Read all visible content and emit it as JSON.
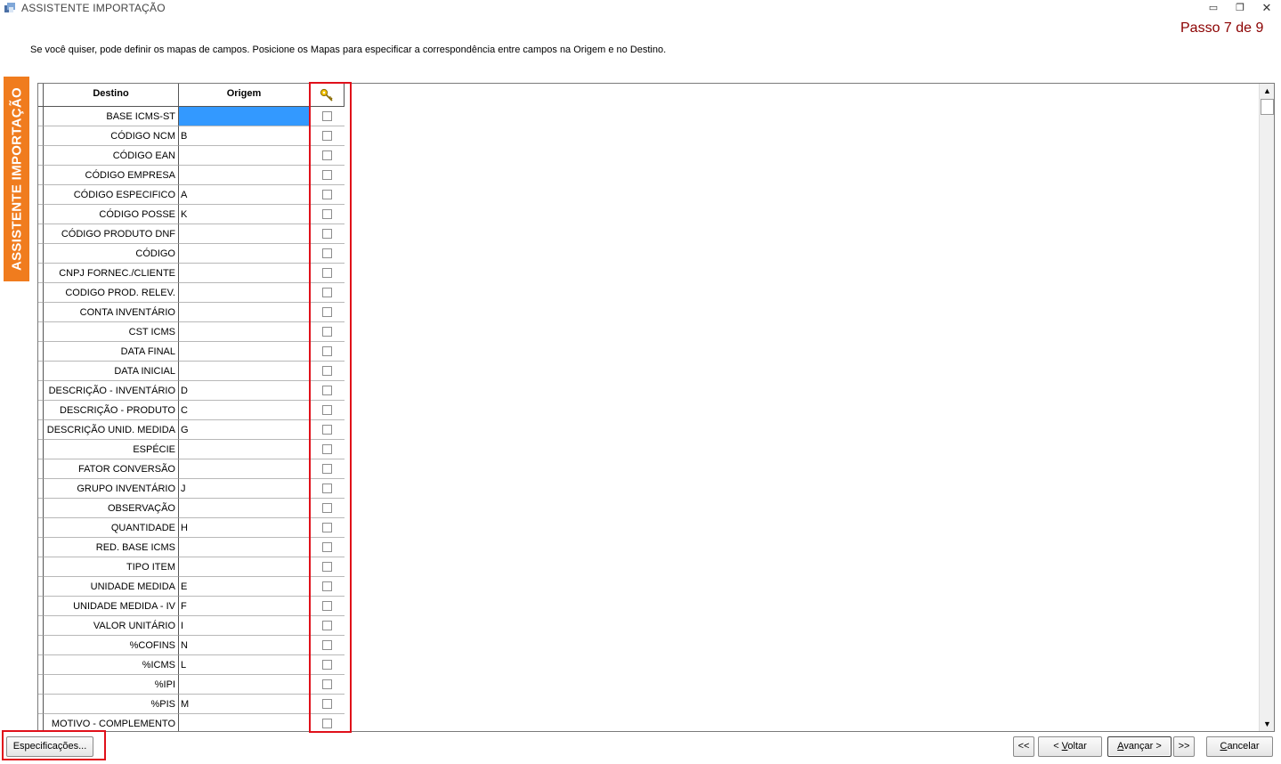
{
  "window": {
    "title": "ASSISTENTE IMPORTAÇÃO",
    "step": "Passo 7 de 9",
    "instructions": "Se você quiser, pode definir os mapas de campos. Posicione os Mapas para especificar a correspondência entre campos na Origem e no Destino."
  },
  "side_banner": "ASSISTENTE IMPORTAÇÃO",
  "grid": {
    "headers": {
      "destino": "Destino",
      "origem": "Origem",
      "key_icon": "key-icon"
    },
    "rows": [
      {
        "destino": "BASE ICMS-ST",
        "origem": "",
        "selected": true
      },
      {
        "destino": "CÓDIGO NCM",
        "origem": "B"
      },
      {
        "destino": "CÓDIGO EAN",
        "origem": ""
      },
      {
        "destino": "CÓDIGO EMPRESA",
        "origem": ""
      },
      {
        "destino": "CÓDIGO ESPECIFICO",
        "origem": "A"
      },
      {
        "destino": "CÓDIGO POSSE",
        "origem": "K"
      },
      {
        "destino": "CÓDIGO PRODUTO DNF",
        "origem": ""
      },
      {
        "destino": "CÓDIGO",
        "origem": ""
      },
      {
        "destino": "CNPJ FORNEC./CLIENTE",
        "origem": ""
      },
      {
        "destino": "CODIGO PROD. RELEV.",
        "origem": ""
      },
      {
        "destino": "CONTA INVENTÁRIO",
        "origem": ""
      },
      {
        "destino": "CST ICMS",
        "origem": ""
      },
      {
        "destino": "DATA FINAL",
        "origem": ""
      },
      {
        "destino": "DATA INICIAL",
        "origem": ""
      },
      {
        "destino": "DESCRIÇÃO - INVENTÁRIO",
        "origem": "D"
      },
      {
        "destino": "DESCRIÇÃO - PRODUTO",
        "origem": "C"
      },
      {
        "destino": "DESCRIÇÃO UNID. MEDIDA",
        "origem": "G"
      },
      {
        "destino": "ESPÉCIE",
        "origem": ""
      },
      {
        "destino": "FATOR CONVERSÃO",
        "origem": ""
      },
      {
        "destino": "GRUPO INVENTÁRIO",
        "origem": "J"
      },
      {
        "destino": "OBSERVAÇÃO",
        "origem": ""
      },
      {
        "destino": "QUANTIDADE",
        "origem": "H"
      },
      {
        "destino": "RED. BASE ICMS",
        "origem": ""
      },
      {
        "destino": "TIPO ITEM",
        "origem": ""
      },
      {
        "destino": "UNIDADE MEDIDA",
        "origem": "E"
      },
      {
        "destino": "UNIDADE MEDIDA - IV",
        "origem": "F"
      },
      {
        "destino": "VALOR UNITÁRIO",
        "origem": "I"
      },
      {
        "destino": "%COFINS",
        "origem": "N"
      },
      {
        "destino": "%ICMS",
        "origem": "L"
      },
      {
        "destino": "%IPI",
        "origem": ""
      },
      {
        "destino": "%PIS",
        "origem": "M"
      },
      {
        "destino": "MOTIVO - COMPLEMENTO",
        "origem": ""
      }
    ]
  },
  "buttons": {
    "specifications": "Especificações...",
    "first": "<<",
    "back_prefix": "< ",
    "back_accel": "V",
    "back_rest": "oltar",
    "next_accel": "A",
    "next_rest": "vançar >",
    "last": ">>",
    "cancel_accel": "C",
    "cancel_rest": "ancelar"
  },
  "colors": {
    "banner": "#f07c1e",
    "step_text": "#8b0000",
    "selection": "#3399ff",
    "highlight_box": "#e0101a"
  }
}
